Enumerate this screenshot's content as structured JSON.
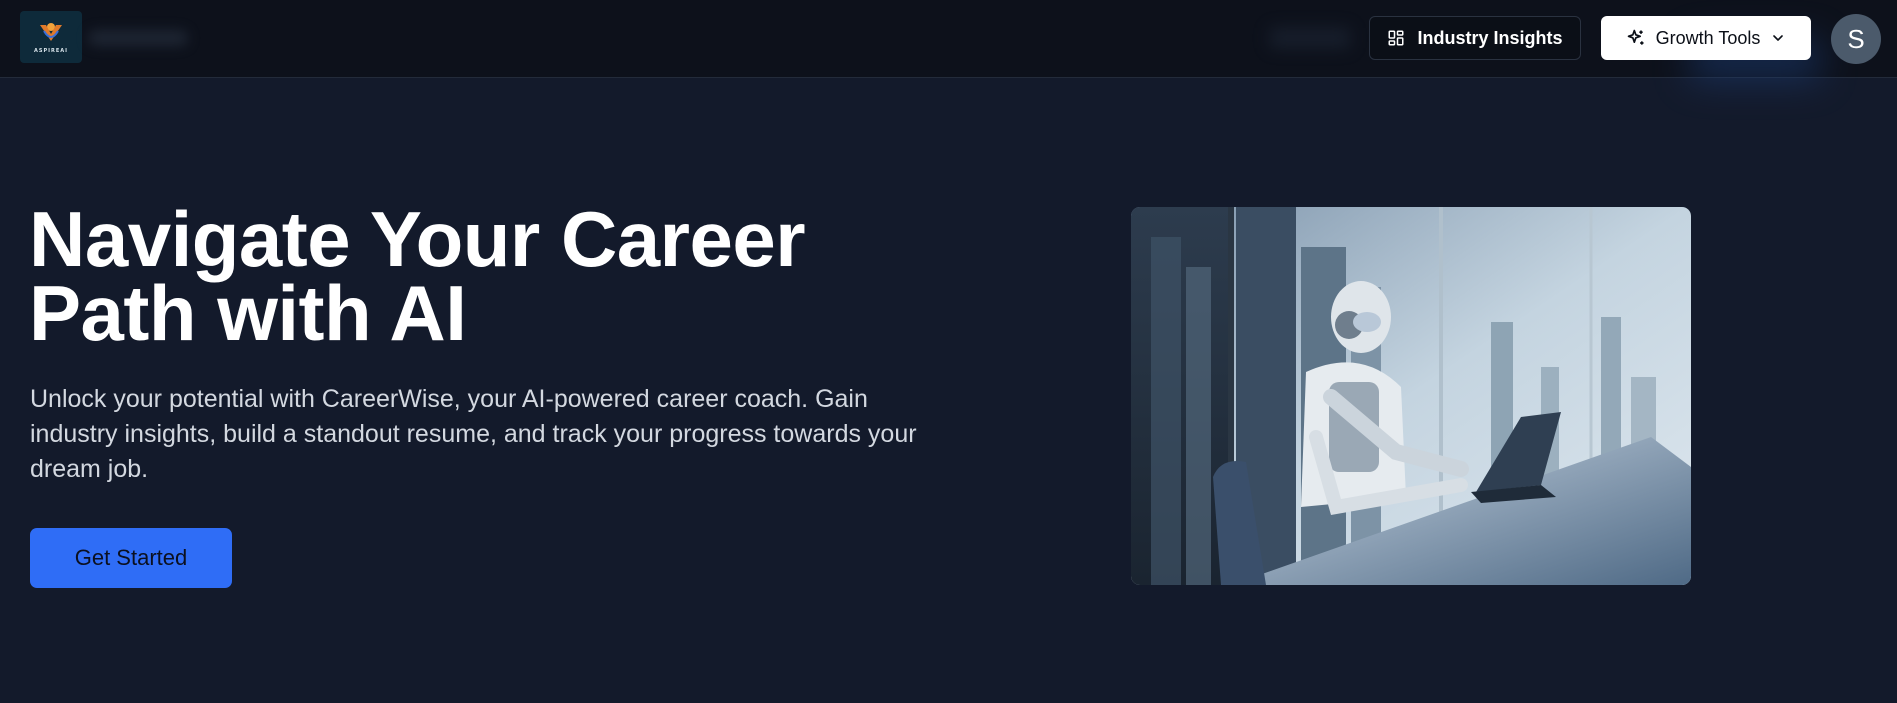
{
  "header": {
    "logo_text": "ASPIREAI",
    "insights_label": "Industry Insights",
    "growth_label": "Growth Tools",
    "avatar_initial": "S"
  },
  "hero": {
    "title": "Navigate Your Career Path with AI",
    "description": "Unlock your potential with CareerWise, your AI-powered career coach. Gain industry insights, build a standout resume, and track your progress towards your dream job.",
    "cta_label": "Get Started"
  },
  "icons": {
    "insights": "layout-dashboard-icon",
    "growth": "sparkles-icon",
    "dropdown": "chevron-down-icon"
  },
  "colors": {
    "background": "#131a2b",
    "header": "#0d111b",
    "accent": "#2f6df6"
  }
}
